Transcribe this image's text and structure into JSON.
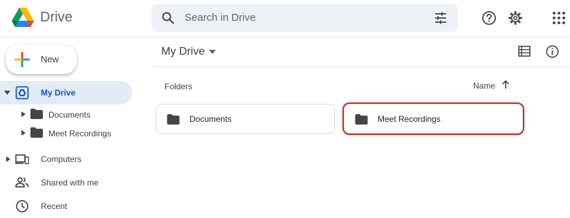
{
  "header": {
    "brand": "Drive",
    "search_placeholder": "Search in Drive",
    "icons": [
      "drive-logo",
      "search-icon",
      "search-options-icon",
      "help-icon",
      "settings-icon",
      "apps-grid-icon"
    ]
  },
  "sidebar": {
    "new_label": "New",
    "my_drive": "My Drive",
    "subfolders": [
      "Documents",
      "Meet Recordings"
    ],
    "computers": "Computers",
    "shared": "Shared with me",
    "recent": "Recent"
  },
  "main": {
    "title": "My Drive",
    "section": "Folders",
    "sort_label": "Name",
    "folders": [
      "Documents",
      "Meet Recordings"
    ]
  },
  "colors": {
    "active_bg": "#e2ebf6",
    "active_text": "#0b57d0",
    "highlight": "#e11d1d",
    "search_bg": "#eef2f7"
  }
}
